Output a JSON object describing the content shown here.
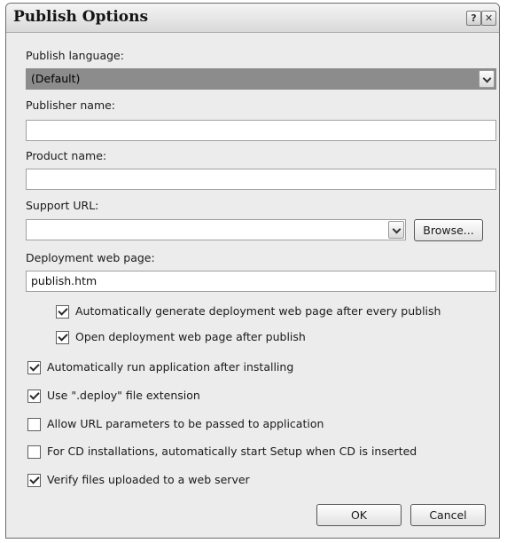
{
  "dialog": {
    "title": "Publish Options",
    "help_glyph": "?",
    "close_glyph": "✕"
  },
  "fields": {
    "publish_language": {
      "label": "Publish language:",
      "value": "(Default)"
    },
    "publisher_name": {
      "label": "Publisher name:",
      "value": ""
    },
    "product_name": {
      "label": "Product name:",
      "value": ""
    },
    "support_url": {
      "label": "Support URL:",
      "value": "",
      "browse_label": "Browse..."
    },
    "deployment_page": {
      "label": "Deployment web page:",
      "value": "publish.htm"
    }
  },
  "checkboxes": [
    {
      "label": "Automatically generate deployment web page after every publish",
      "checked": true
    },
    {
      "label": "Open deployment web page after publish",
      "checked": true
    },
    {
      "label": "Automatically run application after installing",
      "checked": true
    },
    {
      "label": "Use \".deploy\" file extension",
      "checked": true
    },
    {
      "label": "Allow URL parameters to be passed to application",
      "checked": false
    },
    {
      "label": "For CD installations, automatically start Setup when CD is inserted",
      "checked": false
    },
    {
      "label": "Verify files uploaded to a web server",
      "checked": true
    }
  ],
  "buttons": {
    "ok": "OK",
    "cancel": "Cancel"
  },
  "icons": {
    "dropdown": "chevron-down-icon",
    "checkmark": "checkmark-icon"
  }
}
